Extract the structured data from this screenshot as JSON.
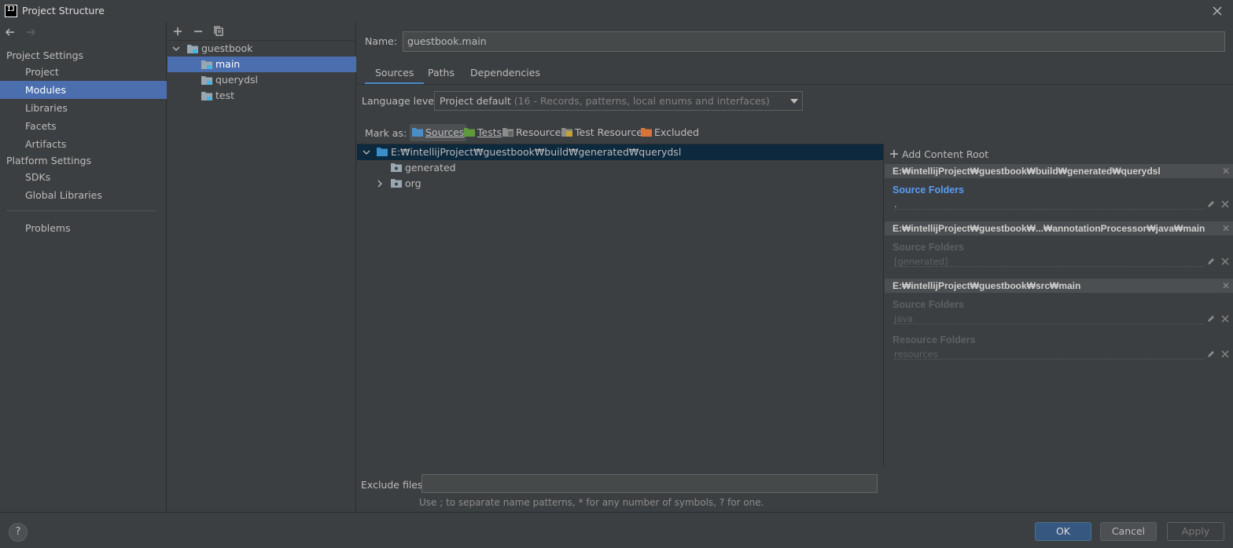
{
  "window": {
    "title": "Project Structure",
    "logo_text": "IJ"
  },
  "sidebar": {
    "categories": [
      "Project Settings",
      "Platform Settings"
    ],
    "items": [
      {
        "label": "Project"
      },
      {
        "label": "Modules",
        "selected": true
      },
      {
        "label": "Libraries"
      },
      {
        "label": "Facets"
      },
      {
        "label": "Artifacts"
      },
      {
        "label": "SDKs"
      },
      {
        "label": "Global Libraries"
      },
      {
        "label": "Problems"
      }
    ]
  },
  "modules": {
    "tree": [
      {
        "label": "guestbook",
        "expanded": true
      },
      {
        "label": "main",
        "selected": true
      },
      {
        "label": "querydsl"
      },
      {
        "label": "test"
      }
    ]
  },
  "main": {
    "name_label": "Name:",
    "name_value": "guestbook.main",
    "tabs": [
      "Sources",
      "Paths",
      "Dependencies"
    ],
    "active_tab": "Sources",
    "language_label": "Language level:",
    "language_value": "Project default",
    "language_hint": "(16 - Records, patterns, local enums and interfaces)",
    "mark_as_label": "Mark as:",
    "mark_buttons": [
      {
        "label": "Sources",
        "color": "#4a8ec8",
        "selected": true
      },
      {
        "label": "Tests",
        "color": "#5f9a3f"
      },
      {
        "label": "Resources",
        "color": "#8c8c8c"
      },
      {
        "label": "Test Resources",
        "color": "#c7a13c"
      },
      {
        "label": "Excluded",
        "color": "#d9733a"
      }
    ],
    "file_tree": [
      {
        "label": "E:₩intellijProject₩guestbook₩build₩generated₩querydsl",
        "selected": true
      },
      {
        "label": "generated"
      },
      {
        "label": "org"
      }
    ],
    "exclude_label": "Exclude files:",
    "exclude_value": "",
    "exclude_hint": "Use ; to separate name patterns, * for any number of symbols, ? for one."
  },
  "roots": {
    "add_label": "Add Content Root",
    "entries": [
      {
        "path": "E:₩intellijProject₩guestbook₩build₩generated₩querydsl",
        "groups": [
          {
            "title": "Source Folders",
            "folder": "."
          }
        ]
      },
      {
        "path": "E:₩intellijProject₩guestbook₩...₩annotationProcessor₩java₩main",
        "groups": [
          {
            "title": "Source Folders",
            "folder": "[generated]"
          }
        ]
      },
      {
        "path": "E:₩intellijProject₩guestbook₩src₩main",
        "groups": [
          {
            "title": "Source Folders",
            "folder": "java"
          },
          {
            "title": "Resource Folders",
            "folder": "resources"
          }
        ]
      }
    ],
    "close_glyph": "✕"
  },
  "footer": {
    "help": "?",
    "ok": "OK",
    "cancel": "Cancel",
    "apply": "Apply"
  }
}
